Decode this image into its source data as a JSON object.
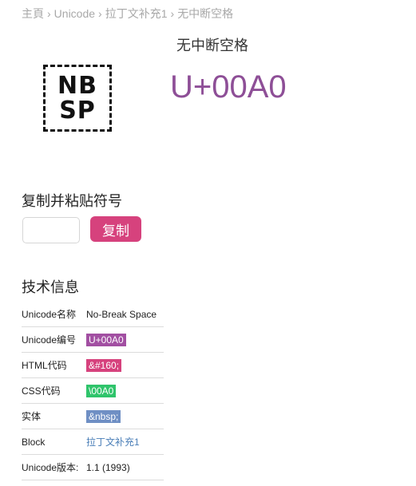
{
  "breadcrumb": {
    "home": "主頁",
    "unicode": "Unicode",
    "block": "拉丁文补充1",
    "current": "无中断空格",
    "separator": "›"
  },
  "character": {
    "name": "无中断空格",
    "glyph_line1": "NB",
    "glyph_line2": "SP",
    "codepoint": "U+00A0"
  },
  "copy_section": {
    "title": "复制并粘贴符号",
    "input_value": "",
    "button_label": "复制"
  },
  "tech_info": {
    "title": "技术信息",
    "rows": [
      {
        "key": "Unicode名称",
        "value": "No-Break Space"
      },
      {
        "key": "Unicode编号",
        "value": "U+00A0"
      },
      {
        "key": "HTML代码",
        "value": "&#160;"
      },
      {
        "key": "CSS代码",
        "value": "\\00A0"
      },
      {
        "key": "实体",
        "value": "&nbsp;"
      },
      {
        "key": "Block",
        "value": "拉丁文补充1"
      },
      {
        "key": "Unicode版本:",
        "value": "1.1 (1993)"
      }
    ]
  },
  "colors": {
    "codepoint": "#8e4f97",
    "unicode_chip": "#a24fa2",
    "html_chip": "#d6427d",
    "css_chip": "#2fc46b",
    "entity_chip": "#6f8fc4",
    "copy_button": "#d6427d",
    "link": "#4b7fb8"
  }
}
